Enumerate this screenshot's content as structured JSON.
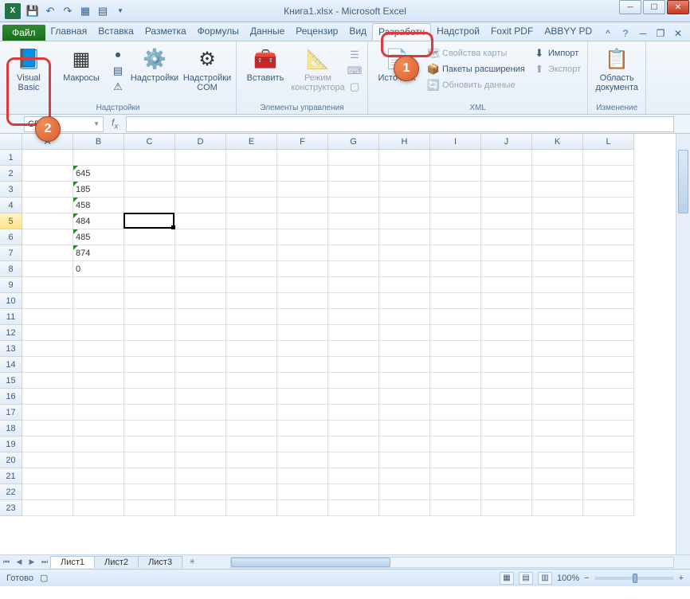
{
  "title": "Книга1.xlsx - Microsoft Excel",
  "tabs": {
    "file": "Файл",
    "list": [
      "Главная",
      "Вставка",
      "Разметка",
      "Формулы",
      "Данные",
      "Рецензир",
      "Вид",
      "Разработч",
      "Надстрой",
      "Foxit PDF",
      "ABBYY PD"
    ],
    "active_index": 7
  },
  "ribbon": {
    "vb": "Visual\nBasic",
    "macros": "Макросы",
    "addins": "Надстройки",
    "addins_com": "Надстройки COM",
    "group_addins": "Надстройки",
    "insert": "Вставить",
    "design_mode": "Режим конструктора",
    "group_controls": "Элементы управления",
    "source": "Источник",
    "map_props": "Свойства карты",
    "exp_packs": "Пакеты расширения",
    "refresh": "Обновить данные",
    "import": "Импорт",
    "export": "Экспорт",
    "group_xml": "XML",
    "doc_panel": "Область документа",
    "group_modify": "Изменение"
  },
  "namebox": "C5",
  "columns": [
    "A",
    "B",
    "C",
    "D",
    "E",
    "F",
    "G",
    "H",
    "I",
    "J",
    "K",
    "L"
  ],
  "rows": 23,
  "selected_row": 5,
  "data_b": {
    "2": "645",
    "3": "185",
    "4": "458",
    "5": "484",
    "6": "485",
    "7": "874",
    "8": "0"
  },
  "text_marker_rows": [
    2,
    3,
    4,
    5,
    6,
    7
  ],
  "selection": {
    "col": 2,
    "row": 5
  },
  "sheets": [
    "Лист1",
    "Лист2",
    "Лист3"
  ],
  "active_sheet": 0,
  "status": {
    "ready": "Готово",
    "zoom": "100%"
  },
  "bubbles": {
    "b1": "1",
    "b2": "2"
  }
}
